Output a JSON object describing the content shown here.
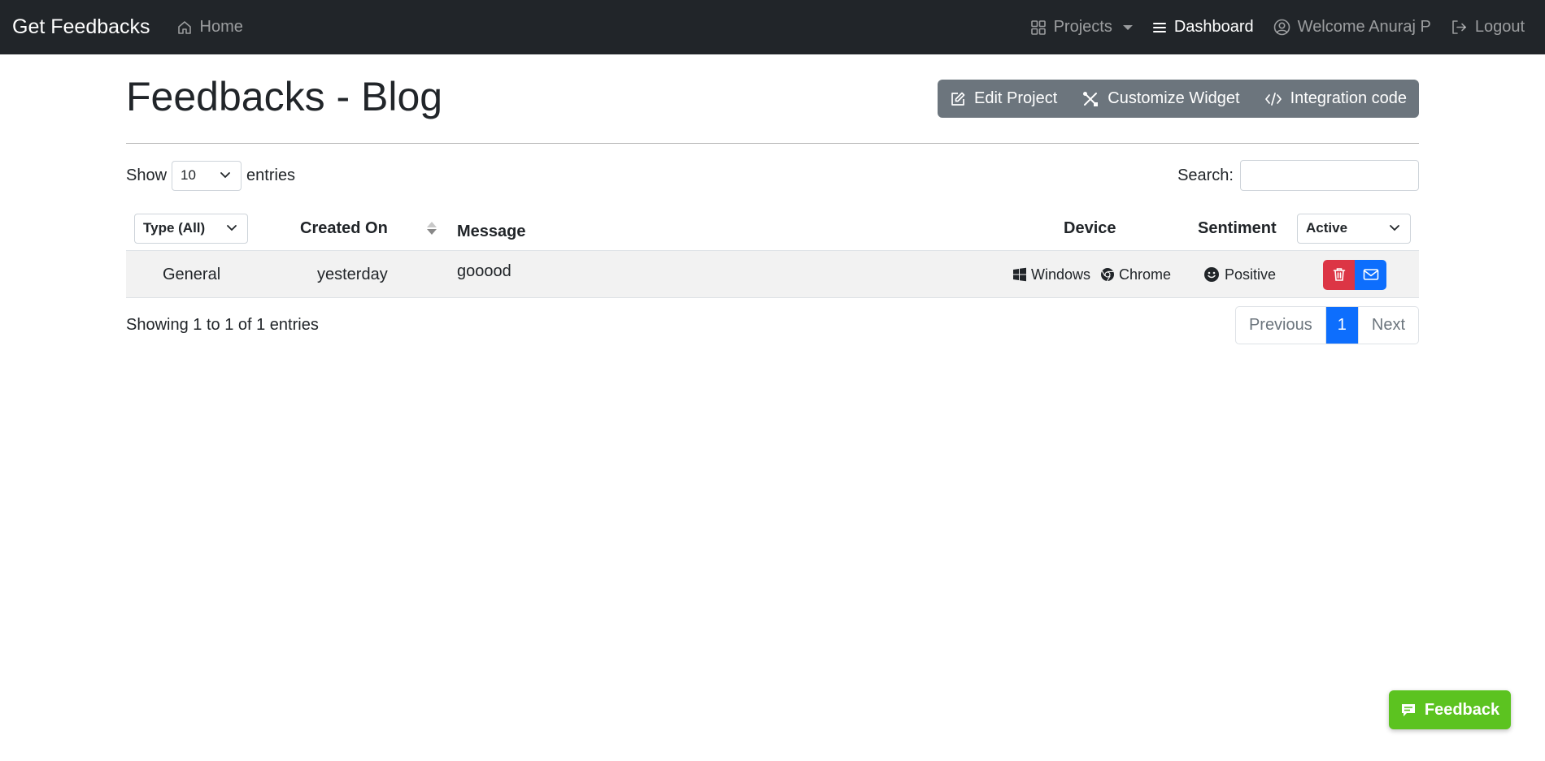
{
  "navbar": {
    "brand": "Get Feedbacks",
    "home": "Home",
    "projects": "Projects",
    "dashboard": "Dashboard",
    "welcome": "Welcome Anuraj P",
    "logout": "Logout"
  },
  "page": {
    "title": "Feedbacks - Blog",
    "buttons": {
      "edit": "Edit Project",
      "customize": "Customize Widget",
      "integration": "Integration code"
    }
  },
  "controls": {
    "show": "Show",
    "entries": "entries",
    "length_value": "10",
    "search_label": "Search:",
    "search_value": ""
  },
  "table": {
    "type_filter": "Type (All)",
    "headers": {
      "created": "Created On",
      "message": "Message",
      "device": "Device",
      "sentiment": "Sentiment"
    },
    "status_filter": "Active",
    "rows": [
      {
        "type": "General",
        "created": "yesterday",
        "message": "gooood",
        "os": "Windows",
        "browser": "Chrome",
        "sentiment": "Positive"
      }
    ]
  },
  "footer": {
    "info": "Showing 1 to 1 of 1 entries",
    "previous": "Previous",
    "page": "1",
    "next": "Next"
  },
  "widget": {
    "label": "Feedback"
  },
  "colors": {
    "navbar": "#212529",
    "button_group": "#6c757d",
    "danger": "#dc3545",
    "primary": "#0d6efd",
    "feedback": "#5cc320"
  }
}
